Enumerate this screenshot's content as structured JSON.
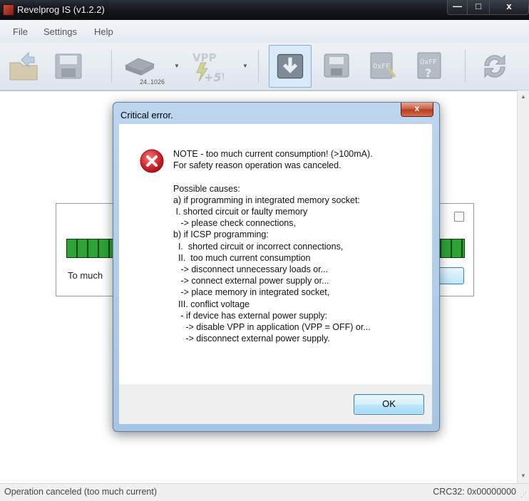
{
  "window": {
    "title": "Revelprog IS (v1.2.2)",
    "min_symbol": "—",
    "max_symbol": "□",
    "close_symbol": "x"
  },
  "menu": {
    "items": [
      "File",
      "Settings",
      "Help"
    ]
  },
  "toolbar": {
    "device_label": "24..1026",
    "vpp_label": "VPP +5V",
    "buttons": [
      {
        "icon": "open-folder-icon"
      },
      {
        "icon": "save-disk-icon"
      },
      {
        "icon": "eeprom-chip-icon"
      },
      {
        "icon": "vpp-power-icon"
      },
      {
        "icon": "read-chip-icon",
        "active": true
      },
      {
        "icon": "write-chip-icon"
      },
      {
        "icon": "erase-0xff-icon"
      },
      {
        "icon": "blank-check-0xff-icon"
      },
      {
        "icon": "refresh-icon"
      }
    ]
  },
  "panel": {
    "message": "To much"
  },
  "dialog": {
    "title": "Critical error.",
    "close_symbol": "x",
    "icon": "error-icon",
    "message": "NOTE - too much current consumption! (>100mA).\nFor safety reason operation was canceled.\n\nPossible causes:\na) if programming in integrated memory socket:\n I. shorted circuit or faulty memory\n   -> please check connections,\nb) if ICSP programming:\n  I.  shorted circuit or incorrect connections,\n  II.  too much current consumption\n   -> disconnect unnecessary loads or...\n   -> connect external power supply or...\n   -> place memory in integrated socket,\n  III. conflict voltage\n   - if device has external power supply:\n     -> disable VPP in application (VPP = OFF) or...\n     -> disconnect external power supply.",
    "ok_label": "OK"
  },
  "status": {
    "left": "Operation canceled (too much current)",
    "right": "CRC32: 0x00000000"
  },
  "colors": {
    "progress_fill": "#2ea234",
    "dialog_frame": "#a6c4e3",
    "error_red": "#c8202b"
  }
}
